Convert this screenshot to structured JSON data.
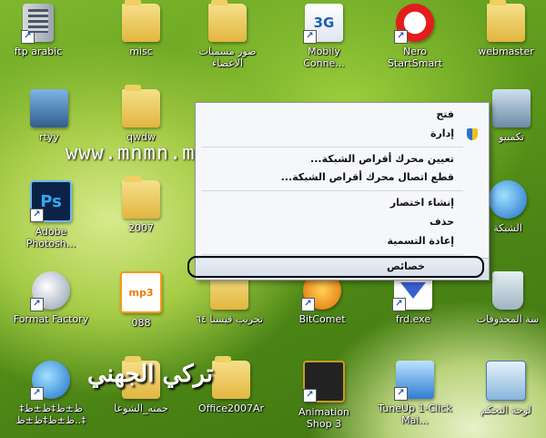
{
  "desktop_icons": [
    {
      "label": "ftp arabic",
      "icon": "server-icon"
    },
    {
      "label": "misc",
      "icon": "folder-icon"
    },
    {
      "label": "صور مسميات الاعضاء",
      "icon": "folder-icon"
    },
    {
      "label": "Mobily Conne...",
      "icon": "mobily-icon"
    },
    {
      "label": "Nero StartSmart",
      "icon": "nero-icon"
    },
    {
      "label": "webmaster",
      "icon": "folder-icon"
    },
    {
      "label": "rtyy",
      "icon": "photo-icon"
    },
    {
      "label": "qwdw",
      "icon": "folder-icon"
    },
    {
      "label": "تكمبيو",
      "icon": "computer-icon"
    },
    {
      "label": "Adobe Photosh...",
      "icon": "photoshop-icon"
    },
    {
      "label": "2007",
      "icon": "folder-icon"
    },
    {
      "label": "الشبكة",
      "icon": "network-icon"
    },
    {
      "label": "Format Factory",
      "icon": "format-factory-icon"
    },
    {
      "label": "088",
      "icon": "quran-icon"
    },
    {
      "label": "تجريب قيسنا ٦٤",
      "icon": "folder-icon"
    },
    {
      "label": "BitComet",
      "icon": "bitcomet-icon"
    },
    {
      "label": "frd.exe",
      "icon": "download-icon"
    },
    {
      "label": "سة المحذوفات",
      "icon": "recycle-bin-icon"
    },
    {
      "label": "ظ±ظ‡ظ±ظ‡ ..ظ±ظ‡ظ±ظ‡",
      "icon": "globe-icon"
    },
    {
      "label": "جمنه_الشوعا",
      "icon": "folder-icon"
    },
    {
      "label": "Office2007Ar",
      "icon": "folder-icon"
    },
    {
      "label": "Animation Shop 3",
      "icon": "animation-shop-icon"
    },
    {
      "label": "TuneUp 1-Click Mai...",
      "icon": "tuneup-icon"
    },
    {
      "label": "لوحة التحكم",
      "icon": "control-panel-icon"
    }
  ],
  "context_menu": {
    "items": [
      {
        "label": "فتح",
        "icon": ""
      },
      {
        "label": "إدارة",
        "icon": "shield-icon"
      },
      {
        "label": "تعيين محرك أقراص الشبكة...",
        "icon": ""
      },
      {
        "label": "قطع اتصال محرك أقراص الشبكة...",
        "icon": ""
      },
      {
        "label": "إنشاء اختصار",
        "icon": ""
      },
      {
        "label": "حذف",
        "icon": ""
      },
      {
        "label": "إعادة التسمية",
        "icon": ""
      },
      {
        "label": "خصائص",
        "icon": ""
      }
    ]
  },
  "watermark": "www.mnmn.mn",
  "logo_text": "تركي الجهني"
}
